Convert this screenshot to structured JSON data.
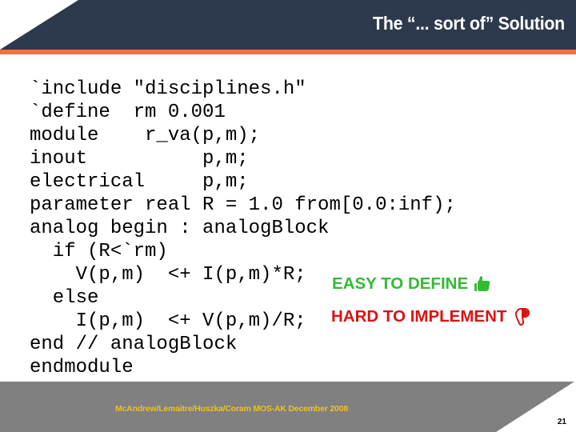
{
  "slide": {
    "title": "The “... sort of” Solution",
    "colors": {
      "header_bg": "#2d3a4d",
      "accent_line": "#f07040",
      "footer_bg": "#808080",
      "footer_text": "#f2c01a",
      "easy": "#33bb33",
      "hard": "#dd1111"
    }
  },
  "code": {
    "language": "Verilog-A",
    "lines": [
      "`include \"disciplines.h\"",
      "`define  rm 0.001",
      "module    r_va(p,m);",
      "inout          p,m;",
      "electrical     p,m;",
      "parameter real R = 1.0 from[0.0:inf);",
      "analog begin : analogBlock",
      "  if (R<`rm)",
      "    V(p,m)  <+ I(p,m)*R;",
      "  else",
      "    I(p,m)  <+ V(p,m)/R;",
      "end // analogBlock",
      "endmodule"
    ]
  },
  "annotations": {
    "easy": {
      "label": "EASY TO DEFINE",
      "icon": "thumbs-up-icon"
    },
    "hard": {
      "label": "HARD TO IMPLEMENT",
      "icon": "thumbs-down-icon"
    }
  },
  "footer": {
    "text": "McAndrew/Lemaitre/Huszka/Coram MOS-AK December 2008",
    "page_number": "21"
  }
}
